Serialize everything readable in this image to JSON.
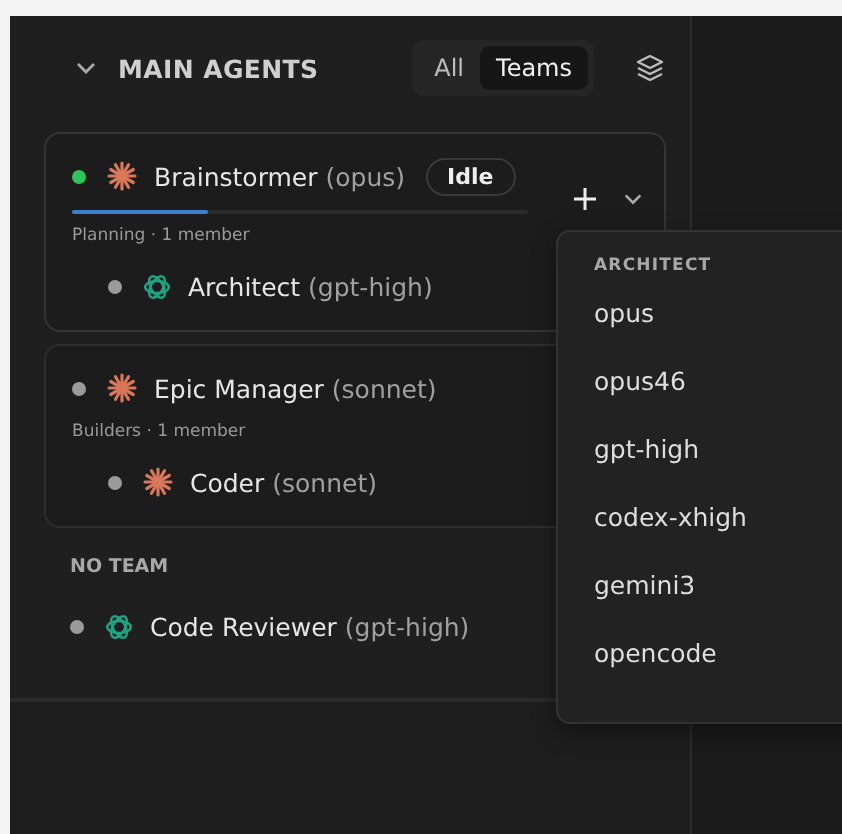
{
  "section": {
    "title": "MAIN AGENTS",
    "expanded": true,
    "view_tabs": [
      {
        "label": "All",
        "selected": false
      },
      {
        "label": "Teams",
        "selected": true
      }
    ]
  },
  "teams": [
    {
      "lead": {
        "name": "Brainstormer",
        "model": "(opus)",
        "kind": "claude",
        "active": true,
        "badge": "Idle"
      },
      "level": 0.3,
      "subtitle": "Planning · 1 member",
      "menu_open": true,
      "members": [
        {
          "name": "Architect",
          "model": "(gpt-high)",
          "kind": "openai",
          "active": false
        }
      ]
    },
    {
      "lead": {
        "name": "Epic Manager",
        "model": "(sonnet)",
        "kind": "claude",
        "active": false
      },
      "subtitle": "Builders · 1 member",
      "menu_open": false,
      "members": [
        {
          "name": "Coder",
          "model": "(sonnet)",
          "kind": "claude",
          "active": false
        }
      ]
    }
  ],
  "no_team": {
    "title": "NO TEAM",
    "agents": [
      {
        "name": "Code Reviewer",
        "model": "(gpt-high)",
        "kind": "openai",
        "active": false
      }
    ]
  },
  "model_menu": {
    "title": "ARCHITECT",
    "items": [
      "opus",
      "opus46",
      "gpt-high",
      "codex-xhigh",
      "gemini3",
      "opencode"
    ]
  }
}
